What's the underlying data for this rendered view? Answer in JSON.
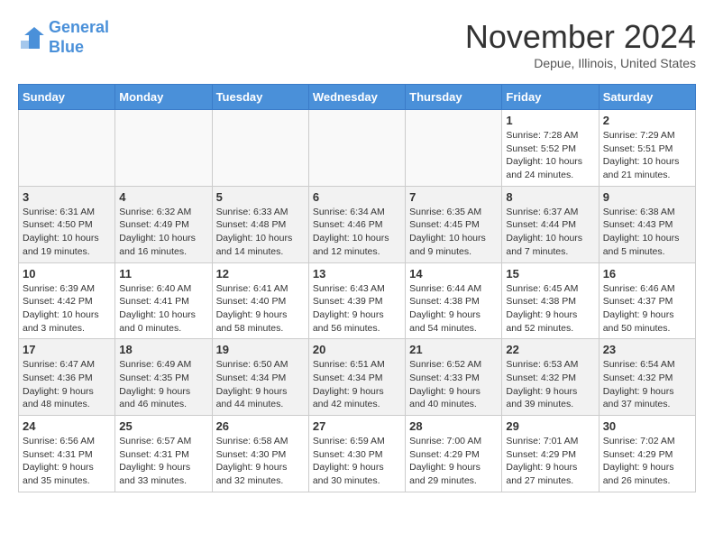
{
  "header": {
    "logo_line1": "General",
    "logo_line2": "Blue",
    "month": "November 2024",
    "location": "Depue, Illinois, United States"
  },
  "days_of_week": [
    "Sunday",
    "Monday",
    "Tuesday",
    "Wednesday",
    "Thursday",
    "Friday",
    "Saturday"
  ],
  "weeks": [
    [
      {
        "num": "",
        "info": ""
      },
      {
        "num": "",
        "info": ""
      },
      {
        "num": "",
        "info": ""
      },
      {
        "num": "",
        "info": ""
      },
      {
        "num": "",
        "info": ""
      },
      {
        "num": "1",
        "info": "Sunrise: 7:28 AM\nSunset: 5:52 PM\nDaylight: 10 hours and 24 minutes."
      },
      {
        "num": "2",
        "info": "Sunrise: 7:29 AM\nSunset: 5:51 PM\nDaylight: 10 hours and 21 minutes."
      }
    ],
    [
      {
        "num": "3",
        "info": "Sunrise: 6:31 AM\nSunset: 4:50 PM\nDaylight: 10 hours and 19 minutes."
      },
      {
        "num": "4",
        "info": "Sunrise: 6:32 AM\nSunset: 4:49 PM\nDaylight: 10 hours and 16 minutes."
      },
      {
        "num": "5",
        "info": "Sunrise: 6:33 AM\nSunset: 4:48 PM\nDaylight: 10 hours and 14 minutes."
      },
      {
        "num": "6",
        "info": "Sunrise: 6:34 AM\nSunset: 4:46 PM\nDaylight: 10 hours and 12 minutes."
      },
      {
        "num": "7",
        "info": "Sunrise: 6:35 AM\nSunset: 4:45 PM\nDaylight: 10 hours and 9 minutes."
      },
      {
        "num": "8",
        "info": "Sunrise: 6:37 AM\nSunset: 4:44 PM\nDaylight: 10 hours and 7 minutes."
      },
      {
        "num": "9",
        "info": "Sunrise: 6:38 AM\nSunset: 4:43 PM\nDaylight: 10 hours and 5 minutes."
      }
    ],
    [
      {
        "num": "10",
        "info": "Sunrise: 6:39 AM\nSunset: 4:42 PM\nDaylight: 10 hours and 3 minutes."
      },
      {
        "num": "11",
        "info": "Sunrise: 6:40 AM\nSunset: 4:41 PM\nDaylight: 10 hours and 0 minutes."
      },
      {
        "num": "12",
        "info": "Sunrise: 6:41 AM\nSunset: 4:40 PM\nDaylight: 9 hours and 58 minutes."
      },
      {
        "num": "13",
        "info": "Sunrise: 6:43 AM\nSunset: 4:39 PM\nDaylight: 9 hours and 56 minutes."
      },
      {
        "num": "14",
        "info": "Sunrise: 6:44 AM\nSunset: 4:38 PM\nDaylight: 9 hours and 54 minutes."
      },
      {
        "num": "15",
        "info": "Sunrise: 6:45 AM\nSunset: 4:38 PM\nDaylight: 9 hours and 52 minutes."
      },
      {
        "num": "16",
        "info": "Sunrise: 6:46 AM\nSunset: 4:37 PM\nDaylight: 9 hours and 50 minutes."
      }
    ],
    [
      {
        "num": "17",
        "info": "Sunrise: 6:47 AM\nSunset: 4:36 PM\nDaylight: 9 hours and 48 minutes."
      },
      {
        "num": "18",
        "info": "Sunrise: 6:49 AM\nSunset: 4:35 PM\nDaylight: 9 hours and 46 minutes."
      },
      {
        "num": "19",
        "info": "Sunrise: 6:50 AM\nSunset: 4:34 PM\nDaylight: 9 hours and 44 minutes."
      },
      {
        "num": "20",
        "info": "Sunrise: 6:51 AM\nSunset: 4:34 PM\nDaylight: 9 hours and 42 minutes."
      },
      {
        "num": "21",
        "info": "Sunrise: 6:52 AM\nSunset: 4:33 PM\nDaylight: 9 hours and 40 minutes."
      },
      {
        "num": "22",
        "info": "Sunrise: 6:53 AM\nSunset: 4:32 PM\nDaylight: 9 hours and 39 minutes."
      },
      {
        "num": "23",
        "info": "Sunrise: 6:54 AM\nSunset: 4:32 PM\nDaylight: 9 hours and 37 minutes."
      }
    ],
    [
      {
        "num": "24",
        "info": "Sunrise: 6:56 AM\nSunset: 4:31 PM\nDaylight: 9 hours and 35 minutes."
      },
      {
        "num": "25",
        "info": "Sunrise: 6:57 AM\nSunset: 4:31 PM\nDaylight: 9 hours and 33 minutes."
      },
      {
        "num": "26",
        "info": "Sunrise: 6:58 AM\nSunset: 4:30 PM\nDaylight: 9 hours and 32 minutes."
      },
      {
        "num": "27",
        "info": "Sunrise: 6:59 AM\nSunset: 4:30 PM\nDaylight: 9 hours and 30 minutes."
      },
      {
        "num": "28",
        "info": "Sunrise: 7:00 AM\nSunset: 4:29 PM\nDaylight: 9 hours and 29 minutes."
      },
      {
        "num": "29",
        "info": "Sunrise: 7:01 AM\nSunset: 4:29 PM\nDaylight: 9 hours and 27 minutes."
      },
      {
        "num": "30",
        "info": "Sunrise: 7:02 AM\nSunset: 4:29 PM\nDaylight: 9 hours and 26 minutes."
      }
    ]
  ]
}
